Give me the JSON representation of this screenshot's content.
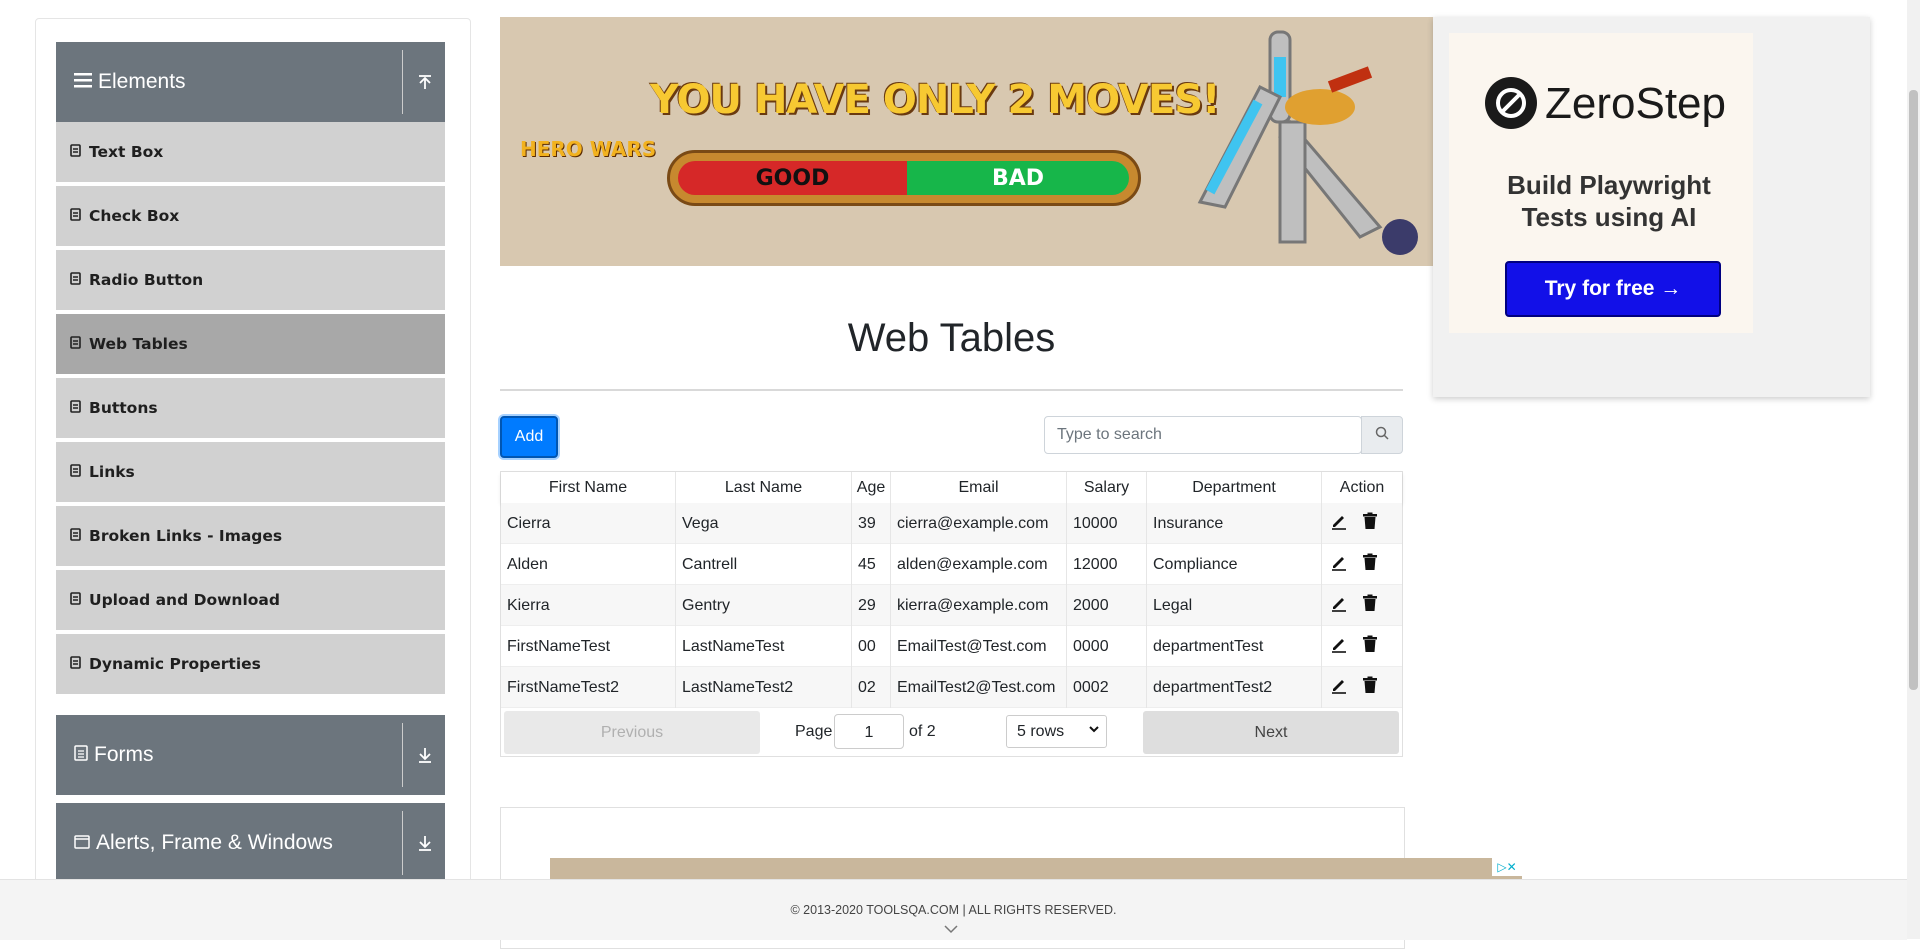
{
  "sidebar": {
    "groups": [
      {
        "label": "Elements"
      },
      {
        "label": "Forms"
      },
      {
        "label": "Alerts, Frame & Windows"
      }
    ],
    "items": [
      {
        "label": "Text Box"
      },
      {
        "label": "Check Box"
      },
      {
        "label": "Radio Button"
      },
      {
        "label": "Web Tables"
      },
      {
        "label": "Buttons"
      },
      {
        "label": "Links"
      },
      {
        "label": "Broken Links - Images"
      },
      {
        "label": "Upload and Download"
      },
      {
        "label": "Dynamic Properties"
      }
    ]
  },
  "banner": {
    "title": "YOU HAVE ONLY 2 MOVES!",
    "logo": "HERO WARS",
    "good": "GOOD",
    "bad": "BAD"
  },
  "ad": {
    "brand": "ZeroStep",
    "tagline1": "Build Playwright",
    "tagline2": "Tests using AI",
    "cta": "Try for free →"
  },
  "main": {
    "title": "Web Tables",
    "add_label": "Add",
    "search_placeholder": "Type to search"
  },
  "table": {
    "headers": [
      "First Name",
      "Last Name",
      "Age",
      "Email",
      "Salary",
      "Department",
      "Action"
    ],
    "rows": [
      [
        "Cierra",
        "Vega",
        "39",
        "cierra@example.com",
        "10000",
        "Insurance"
      ],
      [
        "Alden",
        "Cantrell",
        "45",
        "alden@example.com",
        "12000",
        "Compliance"
      ],
      [
        "Kierra",
        "Gentry",
        "29",
        "kierra@example.com",
        "2000",
        "Legal"
      ],
      [
        "FirstNameTest",
        "LastNameTest",
        "00",
        "EmailTest@Test.com",
        "0000",
        "departmentTest"
      ],
      [
        "FirstNameTest2",
        "LastNameTest2",
        "02",
        "EmailTest2@Test.com",
        "0002",
        "departmentTest2"
      ]
    ]
  },
  "pager": {
    "previous": "Previous",
    "page_label": "Page",
    "page_value": "1",
    "of_label": "of 2",
    "rows_label": "5 rows",
    "next": "Next"
  },
  "footer": {
    "text": "© 2013-2020 TOOLSQA.COM | ALL RIGHTS RESERVED."
  },
  "colors": {
    "accent": "#007bff",
    "sidebar_group": "#6c757d",
    "sidebar_item": "#d1d1d1",
    "sidebar_active": "#a8a8a8",
    "cta": "#1210e8"
  }
}
